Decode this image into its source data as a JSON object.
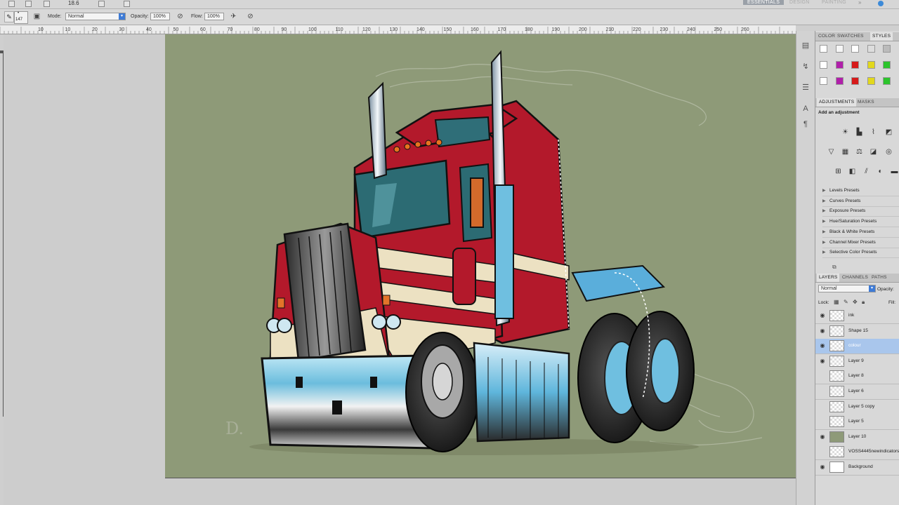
{
  "menubar": {
    "zoom": "18.6",
    "workspaces": [
      "ESSENTIALS",
      "DESIGN",
      "PAINTING"
    ]
  },
  "options": {
    "brush_size": "147",
    "mode_label": "Mode:",
    "mode_value": "Normal",
    "opacity_label": "Opacity:",
    "opacity_value": "100%",
    "flow_label": "Flow:",
    "flow_value": "100%"
  },
  "ruler": {
    "labels": [
      "10",
      "10",
      "20",
      "30",
      "40",
      "50",
      "60",
      "70",
      "80",
      "90",
      "100",
      "110",
      "120",
      "130",
      "140",
      "150",
      "160",
      "170",
      "180",
      "190",
      "200",
      "210",
      "220",
      "230",
      "240",
      "250",
      "260"
    ]
  },
  "colors": {
    "canvas_bg": "#8e9a78",
    "truck_red": "#b3192b",
    "truck_cream": "#ece1c2",
    "chrome_blue": "#7dc5e3",
    "selected_layer": "#a9c6ec",
    "swatch_magenta": "#b01faa",
    "swatch_red": "#d61a1a",
    "swatch_yellow": "#e2d81c",
    "swatch_green": "#2cc42c"
  },
  "panels": {
    "color_tabs": [
      "COLOR",
      "SWATCHES",
      "STYLES"
    ],
    "adjust_tabs": [
      "ADJUSTMENTS",
      "MASKS"
    ],
    "add_adjustment": "Add an adjustment",
    "presets": [
      "Levels Presets",
      "Curves Presets",
      "Exposure Presets",
      "Hue/Saturation Presets",
      "Black & White Presets",
      "Channel Mixer Presets",
      "Selective Color Presets"
    ],
    "layer_tabs": [
      "LAYERS",
      "CHANNELS",
      "PATHS"
    ],
    "blend_mode": "Normal",
    "opacity_label": "Opacity:",
    "lock_label": "Lock:",
    "fill_label": "Fill:"
  },
  "layers": [
    {
      "name": "ink",
      "visible": true
    },
    {
      "name": "Shape 15",
      "visible": true
    },
    {
      "name": "colour",
      "visible": true,
      "selected": true
    },
    {
      "name": "Layer 9",
      "visible": true
    },
    {
      "name": "Layer 8",
      "visible": false
    },
    {
      "name": "Layer 6",
      "visible": false
    },
    {
      "name": "Layer 5 copy",
      "visible": false
    },
    {
      "name": "Layer 5",
      "visible": false
    },
    {
      "name": "Layer 10",
      "visible": true
    },
    {
      "name": "VOSS4445newindicators",
      "visible": false
    },
    {
      "name": "Background",
      "visible": true
    }
  ],
  "canvas": {
    "signature": "D."
  }
}
